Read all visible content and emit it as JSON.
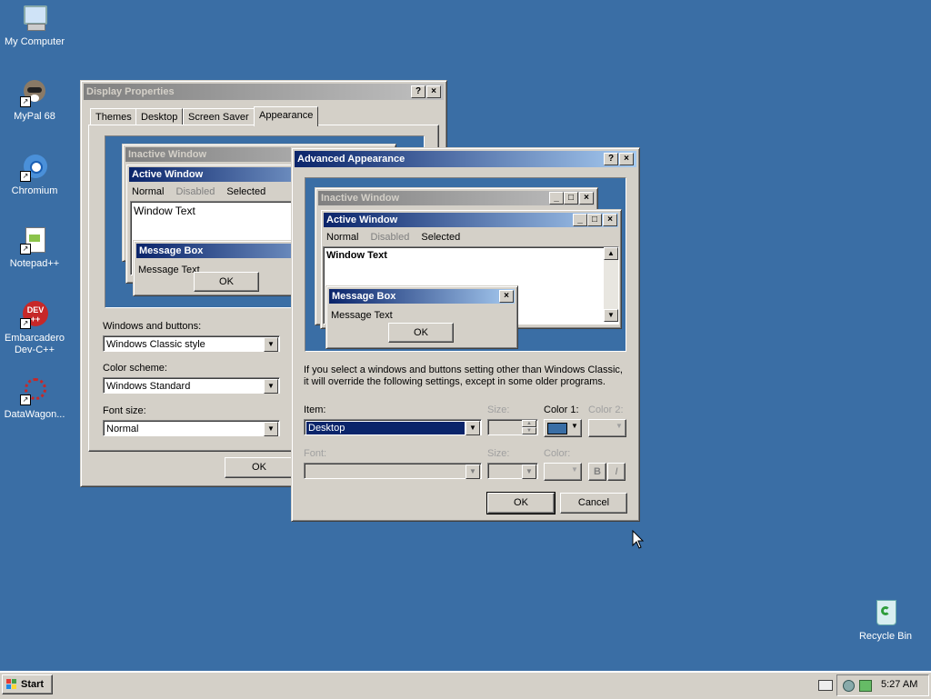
{
  "desktop": {
    "icons": [
      {
        "label": "My Computer",
        "icon": "computer-icon"
      },
      {
        "label": "MyPal 68",
        "icon": "mypal-icon"
      },
      {
        "label": "Chromium",
        "icon": "chromium-icon"
      },
      {
        "label": "Notepad++",
        "icon": "notepadpp-icon"
      },
      {
        "label": "Embarcadero Dev-C++",
        "icon": "devcpp-icon",
        "icon_text": "DEV ++"
      },
      {
        "label": "DataWagon...",
        "icon": "datawagon-icon"
      },
      {
        "label": "Recycle Bin",
        "icon": "recycle-bin-icon"
      }
    ]
  },
  "display_properties": {
    "title": "Display Properties",
    "help_btn": "?",
    "close_btn": "×",
    "tabs": [
      "Themes",
      "Desktop",
      "Screen Saver",
      "Appearance"
    ],
    "selected_tab": "Appearance",
    "preview": {
      "inactive_title": "Inactive Window",
      "active_title": "Active Window",
      "menu": [
        "Normal",
        "Disabled",
        "Selected"
      ],
      "window_text": "Window Text",
      "msgbox_title": "Message Box",
      "msgbox_text": "Message Text",
      "ok": "OK"
    },
    "windows_buttons_label": "Windows and buttons:",
    "windows_buttons_value": "Windows Classic style",
    "color_scheme_label": "Color scheme:",
    "color_scheme_value": "Windows Standard",
    "font_size_label": "Font size:",
    "font_size_value": "Normal",
    "ok": "OK"
  },
  "advanced_appearance": {
    "title": "Advanced Appearance",
    "help_btn": "?",
    "close_btn": "×",
    "preview": {
      "inactive_title": "Inactive Window",
      "active_title": "Active Window",
      "menu": [
        "Normal",
        "Disabled",
        "Selected"
      ],
      "window_text": "Window Text",
      "msgbox_title": "Message Box",
      "msgbox_text": "Message Text",
      "ok": "OK"
    },
    "info_text_1": "If you select a windows and buttons setting other than Windows Classic,",
    "info_text_2": "it will override the following settings, except in some older programs.",
    "item_label": "Item:",
    "item_value": "Desktop",
    "size_label": "Size:",
    "color1_label": "Color 1:",
    "color2_label": "Color 2:",
    "font_label": "Font:",
    "font_size_label": "Size:",
    "font_color_label": "Color:",
    "bold_btn": "B",
    "italic_btn": "I",
    "ok": "OK",
    "cancel": "Cancel",
    "color1_value": "#3a6ea5"
  },
  "taskbar": {
    "start": "Start",
    "time": "5:27 AM"
  },
  "colors": {
    "desktop": "#3a6ea5",
    "active_title_start": "#0a246a",
    "active_title_end": "#a6caf0",
    "face": "#d4d0c8"
  }
}
